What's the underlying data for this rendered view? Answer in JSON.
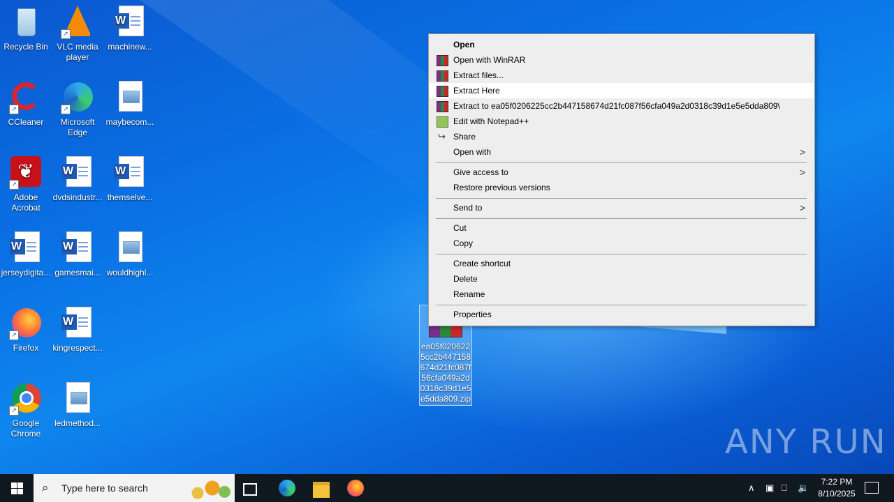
{
  "desktop": {
    "icons": [
      {
        "label": "Recycle Bin"
      },
      {
        "label": "VLC media player"
      },
      {
        "label": "machinew..."
      },
      {
        "label": "CCleaner"
      },
      {
        "label": "Microsoft Edge"
      },
      {
        "label": "maybecom..."
      },
      {
        "label": "Adobe Acrobat"
      },
      {
        "label": "dvdsindustr..."
      },
      {
        "label": "themselve..."
      },
      {
        "label": "jerseydigita..."
      },
      {
        "label": "gamesmai..."
      },
      {
        "label": "wouldhighl..."
      },
      {
        "label": "Firefox"
      },
      {
        "label": "kingrespect..."
      },
      {
        "label": "Google Chrome"
      },
      {
        "label": "ledmethod..."
      }
    ],
    "selected_file": {
      "label": "ea05f0206225cc2b447158674d21fc087f56cfa049a2d0318c39d1e5e5dda809.zip"
    }
  },
  "context_menu": {
    "items": [
      {
        "label": "Open"
      },
      {
        "label": "Open with WinRAR"
      },
      {
        "label": "Extract files..."
      },
      {
        "label": "Extract Here"
      },
      {
        "label": "Extract to ea05f0206225cc2b447158674d21fc087f56cfa049a2d0318c39d1e5e5dda809\\"
      },
      {
        "label": "Edit with Notepad++"
      },
      {
        "label": "Share"
      },
      {
        "label": "Open with"
      },
      {
        "label": "Give access to"
      },
      {
        "label": "Restore previous versions"
      },
      {
        "label": "Send to"
      },
      {
        "label": "Cut"
      },
      {
        "label": "Copy"
      },
      {
        "label": "Create shortcut"
      },
      {
        "label": "Delete"
      },
      {
        "label": "Rename"
      },
      {
        "label": "Properties"
      }
    ]
  },
  "watermark": "ANY RUN",
  "taskbar": {
    "search_placeholder": "Type here to search",
    "time": "7:22 PM",
    "date": "8/10/2025"
  }
}
